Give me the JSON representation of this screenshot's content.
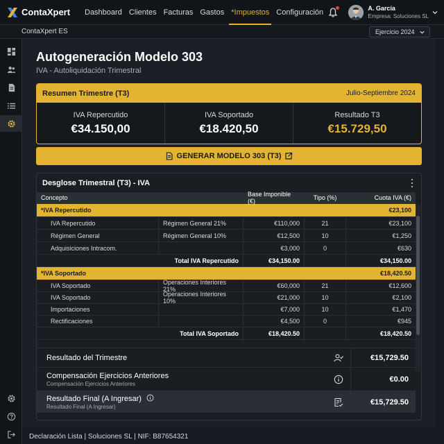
{
  "app": {
    "name": "ContaXpert",
    "nav": [
      "Dashboard",
      "Clientes",
      "Facturas",
      "Gastos",
      "*Impuestos",
      "Configuración"
    ],
    "active_nav": "*Impuestos",
    "user": {
      "name": "A. García",
      "company": "Empresa: Soluciones SL"
    }
  },
  "subbar": {
    "org": "ContaXpert ES",
    "year": "Ejercicio 2024"
  },
  "rail": {
    "icons": [
      "dashboard-icon",
      "users-icon",
      "document-icon",
      "list-icon",
      "settings-icon"
    ],
    "active": "settings-icon",
    "bottom_icons": [
      "settings-icon",
      "help-icon",
      "logout-icon"
    ]
  },
  "page": {
    "title": "Autogeneración Modelo 303",
    "subtitle": "IVA - Autoliquidación Trimestral"
  },
  "summary": {
    "title": "Resumen Trimestre (T3)",
    "period": "Julio-Septiembre 2024",
    "items": [
      {
        "label": "IVA Repercutido",
        "value": "€34.150,00"
      },
      {
        "label": "IVA Soportado",
        "value": "€18.420,50"
      },
      {
        "label": "Resultado T3",
        "value": "€15.729,50"
      }
    ]
  },
  "generate_button": "GENERAR MODELO 303 (T3)",
  "breakdown": {
    "title": "Desglose Trimestral (T3) - IVA",
    "headers": [
      "Concepto",
      "",
      "Base Imponible (€)",
      "Tipo (%)",
      "Cuota IVA (€)"
    ],
    "repercutido": {
      "label": "*IVA Repercutido",
      "amount": "€23,100",
      "rows": [
        [
          "IVA Repercutido",
          "Régimen General 21%",
          "€110,000",
          "21",
          "€23,100"
        ],
        [
          "Régimen General",
          "Régimen General 10%",
          "€12,500",
          "10",
          "€1,250"
        ],
        [
          "Adquisiciones Intracom.",
          "",
          "€3,000",
          "0",
          "€630"
        ]
      ],
      "total": {
        "label": "Total IVA Repercutido",
        "base": "€34,150.00",
        "cuota": "€34,150.00"
      }
    },
    "soportado": {
      "label": "*IVA Soportado",
      "amount": "€18,420.50",
      "rows": [
        [
          "IVA Soportado",
          "Operaciones Interiores 21%",
          "€60,000",
          "21",
          "€12,600"
        ],
        [
          "IVA Soportado",
          "Operaciones Interiores 10%",
          "€21,000",
          "10",
          "€2,100"
        ],
        [
          "Importaciones",
          "",
          "€7,000",
          "10",
          "€1,470"
        ],
        [
          "Rectificaciones",
          "",
          "€4,500",
          "0",
          "€945"
        ]
      ],
      "total": {
        "label": "Total IVA Soportado",
        "base": "€18,420.50",
        "cuota": "€18,420.50"
      }
    },
    "results": [
      {
        "label": "Resultado del Trimestre",
        "sub": "",
        "value": "€15,729.50",
        "icon": "user-check-icon"
      },
      {
        "label": "Compensación Ejercicios Anteriores",
        "sub": "Compensación Ejercicios Anteriores",
        "value": "€0.00",
        "icon": "info-icon"
      },
      {
        "label": "Resultado Final (A Ingresar)",
        "sub": "Resultado Final (A Ingresar)",
        "value": "€15,729.50",
        "icon": "form-check-icon"
      }
    ]
  },
  "footer": "Declaración Lista | Soluciones SL | NIF: B87654321",
  "colors": {
    "accent": "#e3b431",
    "background": "#16191f",
    "panel": "#1c1f25"
  }
}
